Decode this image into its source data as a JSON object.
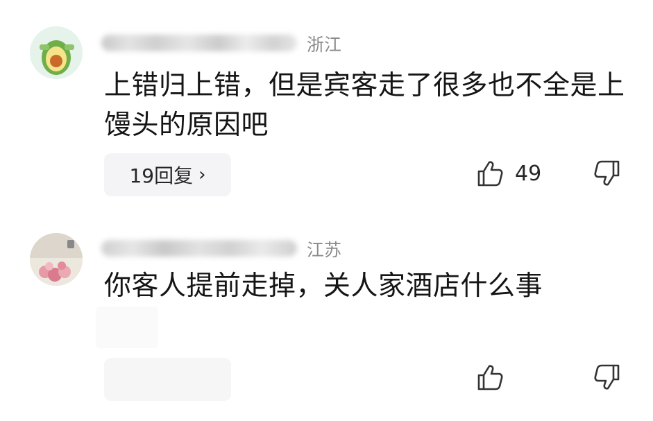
{
  "comments": [
    {
      "region": "浙江",
      "text": "上错归上错，但是宾客走了很多也不全是上馒头的原因吧",
      "reply_label": "19回复",
      "reply_chevron": "›",
      "likes": "49",
      "avatar_icon": "avocado-avatar",
      "colors": {
        "avatar_bg": "#e7f4ec"
      }
    },
    {
      "region": "江苏",
      "text": "你客人提前走掉，关人家酒店什么事",
      "reply_label": "",
      "likes": "",
      "avatar_icon": "flower-photo-avatar",
      "colors": {
        "avatar_bg": "#e9e4dc"
      }
    }
  ],
  "icons": {
    "like": "thumbs-up-icon",
    "dislike": "thumbs-down-icon"
  }
}
